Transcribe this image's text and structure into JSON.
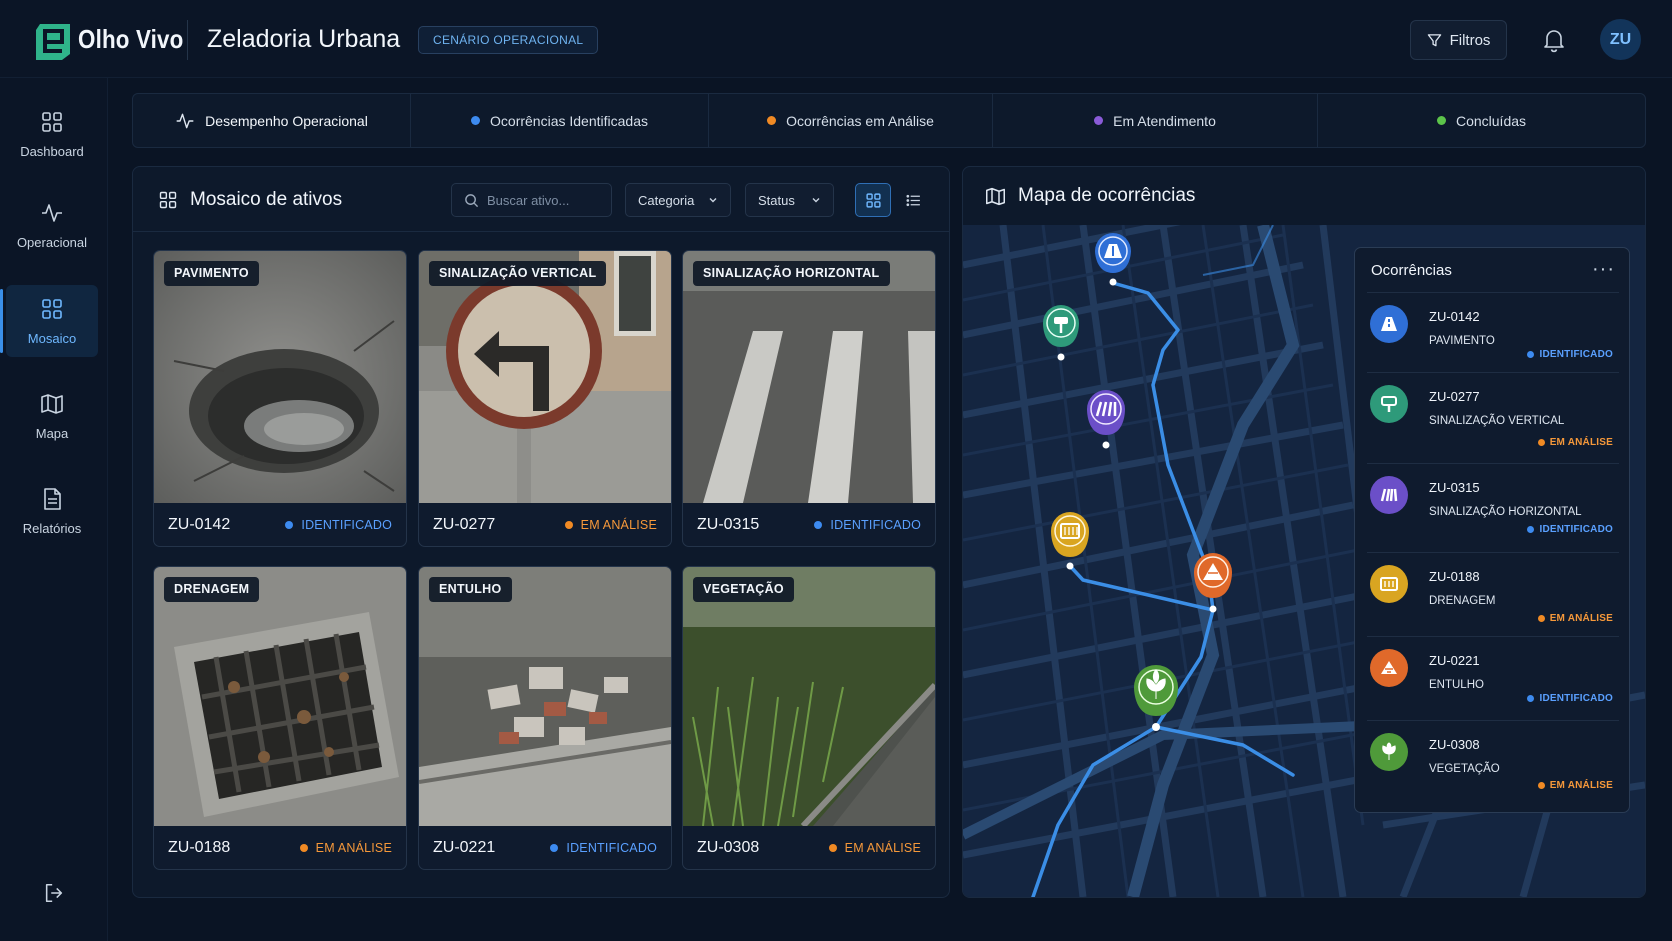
{
  "header": {
    "brand": "Olho Vivo",
    "app_title": "Zeladoria Urbana",
    "scenario_badge": "CENÁRIO OPERACIONAL",
    "filters_label": "Filtros",
    "avatar_initials": "ZU"
  },
  "sidebar": {
    "items": [
      {
        "label": "Dashboard",
        "icon": "grid-icon"
      },
      {
        "label": "Operacional",
        "icon": "activity-icon"
      },
      {
        "label": "Mosaico",
        "icon": "grid-icon",
        "active": true
      },
      {
        "label": "Mapa",
        "icon": "map-icon"
      },
      {
        "label": "Relatórios",
        "icon": "report-icon"
      }
    ],
    "logout_icon": "logout-icon"
  },
  "statusbar": {
    "performance": "Desempenho Operacional",
    "cells": [
      {
        "label": "Ocorrências Identificadas",
        "color": "#3d8bf0"
      },
      {
        "label": "Ocorrências em Análise",
        "color": "#f08a24"
      },
      {
        "label": "Em Atendimento",
        "color": "#8a5bd8"
      },
      {
        "label": "Concluídas",
        "color": "#5cc44a"
      }
    ]
  },
  "mosaic": {
    "title": "Mosaico de ativos",
    "search_placeholder": "Buscar ativo...",
    "category_select": "Categoria",
    "status_select": "Status",
    "cards": [
      {
        "tag": "PAVIMENTO",
        "code": "ZU-0142",
        "status": "IDENTIFICADO",
        "status_color": "#3d8bf0",
        "scene": "pothole"
      },
      {
        "tag": "SINALIZAÇÃO VERTICAL",
        "code": "ZU-0277",
        "status": "EM ANÁLISE",
        "status_color": "#f08a24",
        "scene": "sign"
      },
      {
        "tag": "SINALIZAÇÃO HORIZONTAL",
        "code": "ZU-0315",
        "status": "IDENTIFICADO",
        "status_color": "#3d8bf0",
        "scene": "crosswalk"
      },
      {
        "tag": "DRENAGEM",
        "code": "ZU-0188",
        "status": "EM ANÁLISE",
        "status_color": "#f08a24",
        "scene": "drain"
      },
      {
        "tag": "ENTULHO",
        "code": "ZU-0221",
        "status": "IDENTIFICADO",
        "status_color": "#3d8bf0",
        "scene": "rubble"
      },
      {
        "tag": "VEGETAÇÃO",
        "code": "ZU-0308",
        "status": "EM ANÁLISE",
        "status_color": "#f08a24",
        "scene": "vegetation"
      }
    ]
  },
  "map": {
    "title": "Mapa de ocorrências",
    "panel_title": "Ocorrências",
    "occurrences": [
      {
        "code": "ZU-0142",
        "category": "PAVIMENTO",
        "status": "IDENTIFICADO",
        "status_color": "#3d8bf0",
        "icon_color": "#2f6fd6",
        "icon": "road-icon"
      },
      {
        "code": "ZU-0277",
        "category": "SINALIZAÇÃO VERTICAL",
        "status": "EM ANÁLISE",
        "status_color": "#f08a24",
        "icon_color": "#2e9a7a",
        "icon": "signpost-icon"
      },
      {
        "code": "ZU-0315",
        "category": "SINALIZAÇÃO HORIZONTAL",
        "status": "IDENTIFICADO",
        "status_color": "#3d8bf0",
        "icon_color": "#6b4fc8",
        "icon": "crosswalk-icon"
      },
      {
        "code": "ZU-0188",
        "category": "DRENAGEM",
        "status": "EM ANÁLISE",
        "status_color": "#f08a24",
        "icon_color": "#d9a521",
        "icon": "drain-icon"
      },
      {
        "code": "ZU-0221",
        "category": "ENTULHO",
        "status": "IDENTIFICADO",
        "status_color": "#3d8bf0",
        "icon_color": "#e0692a",
        "icon": "rubble-icon"
      },
      {
        "code": "ZU-0308",
        "category": "VEGETAÇÃO",
        "status": "EM ANÁLISE",
        "status_color": "#f08a24",
        "icon_color": "#4f9a3a",
        "icon": "leaf-icon"
      }
    ]
  }
}
